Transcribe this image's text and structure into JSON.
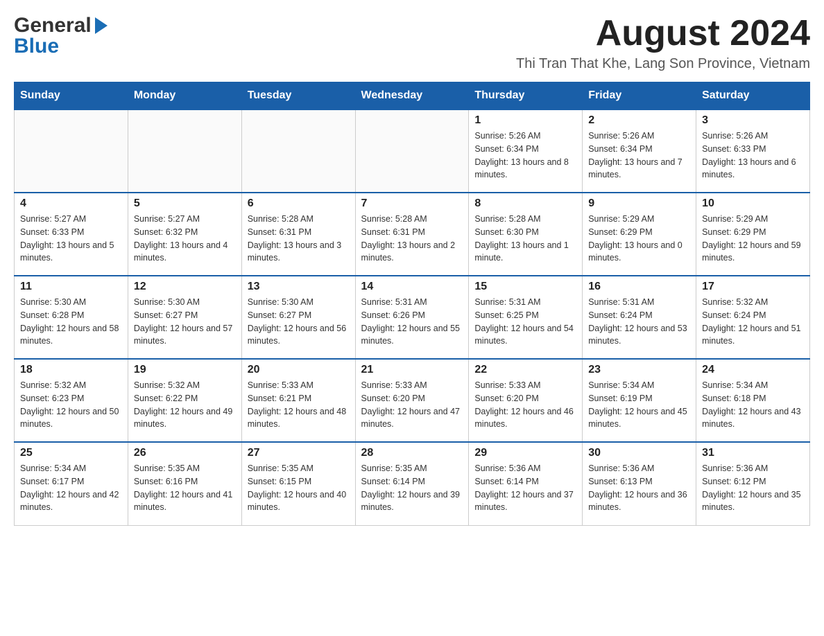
{
  "header": {
    "logo_general": "General",
    "logo_blue": "Blue",
    "month_title": "August 2024",
    "location": "Thi Tran That Khe, Lang Son Province, Vietnam"
  },
  "days_of_week": [
    "Sunday",
    "Monday",
    "Tuesday",
    "Wednesday",
    "Thursday",
    "Friday",
    "Saturday"
  ],
  "weeks": [
    {
      "days": [
        {
          "number": "",
          "info": ""
        },
        {
          "number": "",
          "info": ""
        },
        {
          "number": "",
          "info": ""
        },
        {
          "number": "",
          "info": ""
        },
        {
          "number": "1",
          "info": "Sunrise: 5:26 AM\nSunset: 6:34 PM\nDaylight: 13 hours and 8 minutes."
        },
        {
          "number": "2",
          "info": "Sunrise: 5:26 AM\nSunset: 6:34 PM\nDaylight: 13 hours and 7 minutes."
        },
        {
          "number": "3",
          "info": "Sunrise: 5:26 AM\nSunset: 6:33 PM\nDaylight: 13 hours and 6 minutes."
        }
      ]
    },
    {
      "days": [
        {
          "number": "4",
          "info": "Sunrise: 5:27 AM\nSunset: 6:33 PM\nDaylight: 13 hours and 5 minutes."
        },
        {
          "number": "5",
          "info": "Sunrise: 5:27 AM\nSunset: 6:32 PM\nDaylight: 13 hours and 4 minutes."
        },
        {
          "number": "6",
          "info": "Sunrise: 5:28 AM\nSunset: 6:31 PM\nDaylight: 13 hours and 3 minutes."
        },
        {
          "number": "7",
          "info": "Sunrise: 5:28 AM\nSunset: 6:31 PM\nDaylight: 13 hours and 2 minutes."
        },
        {
          "number": "8",
          "info": "Sunrise: 5:28 AM\nSunset: 6:30 PM\nDaylight: 13 hours and 1 minute."
        },
        {
          "number": "9",
          "info": "Sunrise: 5:29 AM\nSunset: 6:29 PM\nDaylight: 13 hours and 0 minutes."
        },
        {
          "number": "10",
          "info": "Sunrise: 5:29 AM\nSunset: 6:29 PM\nDaylight: 12 hours and 59 minutes."
        }
      ]
    },
    {
      "days": [
        {
          "number": "11",
          "info": "Sunrise: 5:30 AM\nSunset: 6:28 PM\nDaylight: 12 hours and 58 minutes."
        },
        {
          "number": "12",
          "info": "Sunrise: 5:30 AM\nSunset: 6:27 PM\nDaylight: 12 hours and 57 minutes."
        },
        {
          "number": "13",
          "info": "Sunrise: 5:30 AM\nSunset: 6:27 PM\nDaylight: 12 hours and 56 minutes."
        },
        {
          "number": "14",
          "info": "Sunrise: 5:31 AM\nSunset: 6:26 PM\nDaylight: 12 hours and 55 minutes."
        },
        {
          "number": "15",
          "info": "Sunrise: 5:31 AM\nSunset: 6:25 PM\nDaylight: 12 hours and 54 minutes."
        },
        {
          "number": "16",
          "info": "Sunrise: 5:31 AM\nSunset: 6:24 PM\nDaylight: 12 hours and 53 minutes."
        },
        {
          "number": "17",
          "info": "Sunrise: 5:32 AM\nSunset: 6:24 PM\nDaylight: 12 hours and 51 minutes."
        }
      ]
    },
    {
      "days": [
        {
          "number": "18",
          "info": "Sunrise: 5:32 AM\nSunset: 6:23 PM\nDaylight: 12 hours and 50 minutes."
        },
        {
          "number": "19",
          "info": "Sunrise: 5:32 AM\nSunset: 6:22 PM\nDaylight: 12 hours and 49 minutes."
        },
        {
          "number": "20",
          "info": "Sunrise: 5:33 AM\nSunset: 6:21 PM\nDaylight: 12 hours and 48 minutes."
        },
        {
          "number": "21",
          "info": "Sunrise: 5:33 AM\nSunset: 6:20 PM\nDaylight: 12 hours and 47 minutes."
        },
        {
          "number": "22",
          "info": "Sunrise: 5:33 AM\nSunset: 6:20 PM\nDaylight: 12 hours and 46 minutes."
        },
        {
          "number": "23",
          "info": "Sunrise: 5:34 AM\nSunset: 6:19 PM\nDaylight: 12 hours and 45 minutes."
        },
        {
          "number": "24",
          "info": "Sunrise: 5:34 AM\nSunset: 6:18 PM\nDaylight: 12 hours and 43 minutes."
        }
      ]
    },
    {
      "days": [
        {
          "number": "25",
          "info": "Sunrise: 5:34 AM\nSunset: 6:17 PM\nDaylight: 12 hours and 42 minutes."
        },
        {
          "number": "26",
          "info": "Sunrise: 5:35 AM\nSunset: 6:16 PM\nDaylight: 12 hours and 41 minutes."
        },
        {
          "number": "27",
          "info": "Sunrise: 5:35 AM\nSunset: 6:15 PM\nDaylight: 12 hours and 40 minutes."
        },
        {
          "number": "28",
          "info": "Sunrise: 5:35 AM\nSunset: 6:14 PM\nDaylight: 12 hours and 39 minutes."
        },
        {
          "number": "29",
          "info": "Sunrise: 5:36 AM\nSunset: 6:14 PM\nDaylight: 12 hours and 37 minutes."
        },
        {
          "number": "30",
          "info": "Sunrise: 5:36 AM\nSunset: 6:13 PM\nDaylight: 12 hours and 36 minutes."
        },
        {
          "number": "31",
          "info": "Sunrise: 5:36 AM\nSunset: 6:12 PM\nDaylight: 12 hours and 35 minutes."
        }
      ]
    }
  ]
}
